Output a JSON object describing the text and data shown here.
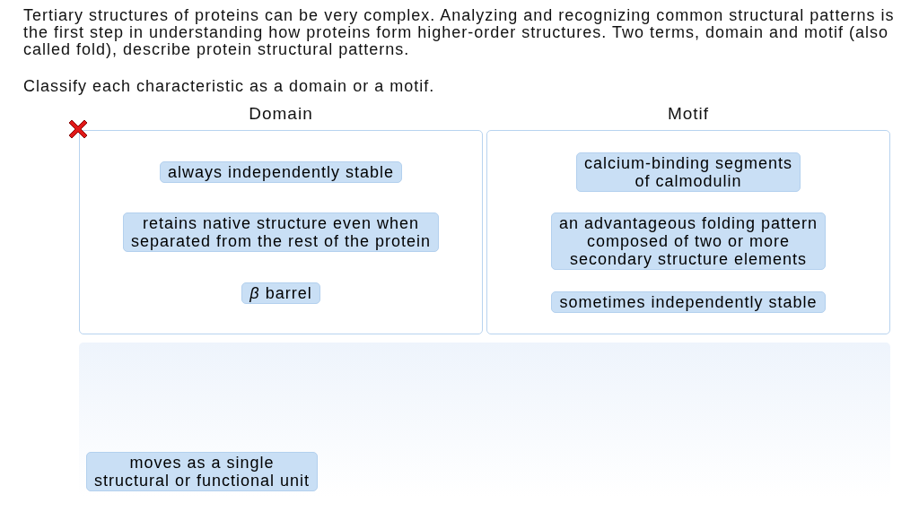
{
  "intro": "Tertiary structures of proteins can be very complex. Analyzing and recognizing common structural patterns is the first step in understanding how proteins form higher-order structures. Two terms, domain and motif (also called fold), describe protein structural patterns.",
  "instruction": "Classify each characteristic as a domain or a motif.",
  "answer_correct": false,
  "bins": [
    {
      "title": "Domain",
      "items": [
        "always independently stable",
        "retains native structure even when\nseparated from the rest of the protein",
        "*β* barrel"
      ]
    },
    {
      "title": "Motif",
      "items": [
        "calcium-binding segments\nof calmodulin",
        "an advantageous folding pattern\ncomposed of two or more\nsecondary structure elements",
        "sometimes independently stable"
      ]
    }
  ],
  "pool": {
    "items": [
      "moves as a single\nstructural or functional unit"
    ]
  }
}
